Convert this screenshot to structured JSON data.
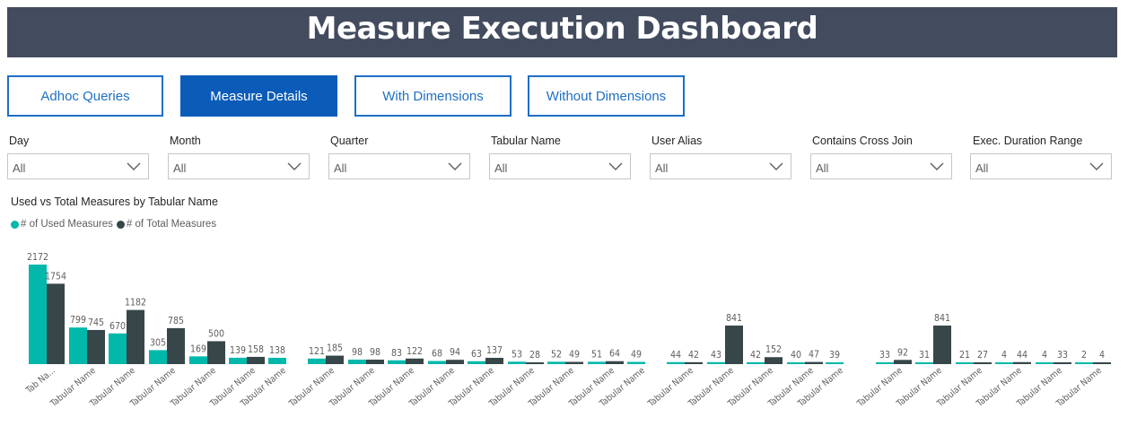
{
  "header": {
    "title": "Measure Execution Dashboard"
  },
  "nav": {
    "adhoc": "Adhoc Queries",
    "measure_details": "Measure Details",
    "with_dimensions": "With Dimensions",
    "without_dimensions": "Without Dimensions"
  },
  "filters": [
    {
      "label": "Day",
      "value": "All"
    },
    {
      "label": "Month",
      "value": "All"
    },
    {
      "label": "Quarter",
      "value": "All"
    },
    {
      "label": "Tabular Name",
      "value": "All"
    },
    {
      "label": "User Alias",
      "value": "All"
    },
    {
      "label": "Contains Cross Join",
      "value": "All"
    },
    {
      "label": "Exec. Duration Range",
      "value": "All"
    }
  ],
  "colors": {
    "header": "#434c5e",
    "accent": "#0a5cb8",
    "used": "#01b8aa",
    "total": "#374649"
  },
  "chart_data": {
    "type": "bar",
    "title": "Used vs Total Measures by Tabular Name",
    "legend_position": "top-left",
    "categories": [
      "Tab Na...",
      "Tabular Name",
      "Tabular Name",
      "Tabular Name",
      "Tabular Name",
      "Tabular Name",
      "Tabular Name",
      "Tabular Name",
      "Tabular Name",
      "Tabular Name",
      "Tabular Name",
      "Tabular Name",
      "Tabular Name",
      "Tabular Name",
      "Tabular Name",
      "Tabular Name",
      "Tabular Name",
      "Tabular Name",
      "Tabular Name",
      "Tabular Name",
      "Tabular Name",
      "Tabular Name",
      "Tabular Name",
      "Tabular Name",
      "Tabular Name",
      "Tabular Name",
      "Tabular Name",
      "Tabular Name",
      "Tabular Name",
      "Tabular Name",
      "Tabular Name",
      "Tabular Name",
      "Tabular Name",
      "Tabular Name",
      "Tabular Name",
      "Tabular Name",
      "Tabular Name",
      "Tabular Name",
      "Tabular Name",
      "Tabular Name",
      "Tabular Name",
      "Tabular Name",
      "Tabular Name",
      "Tabular Name",
      "Tabular Name",
      "Tabular Name",
      "Tabular Name",
      "Tabular Name",
      "Tabular Name",
      "Tabular Name",
      "Tabular Name",
      "Tabular Name",
      "Tabular Name",
      "Tabular Name",
      "Tabular Name"
    ],
    "series": [
      {
        "name": "# of Used Measures",
        "values": [
          2172,
          799,
          670,
          305,
          169,
          139,
          138,
          null,
          121,
          98,
          83,
          68,
          63,
          53,
          52,
          51,
          49,
          null,
          null,
          null,
          null,
          null,
          44,
          43,
          42,
          40,
          39,
          null,
          null,
          null,
          null,
          null,
          33,
          31,
          21,
          4,
          4,
          2
        ]
      },
      {
        "name": "# of Total Measures",
        "values": [
          1754,
          745,
          1182,
          785,
          500,
          158,
          null,
          null,
          185,
          98,
          122,
          94,
          137,
          28,
          49,
          64,
          null,
          null,
          null,
          null,
          null,
          null,
          42,
          841,
          152,
          47,
          null,
          null,
          null,
          null,
          null,
          null,
          92,
          841,
          27,
          44,
          33,
          4
        ]
      }
    ],
    "groups": [
      {
        "name": "# of Used Measures",
        "start": 0
      }
    ],
    "ylim": [
      0,
      2300
    ],
    "grid": false
  }
}
